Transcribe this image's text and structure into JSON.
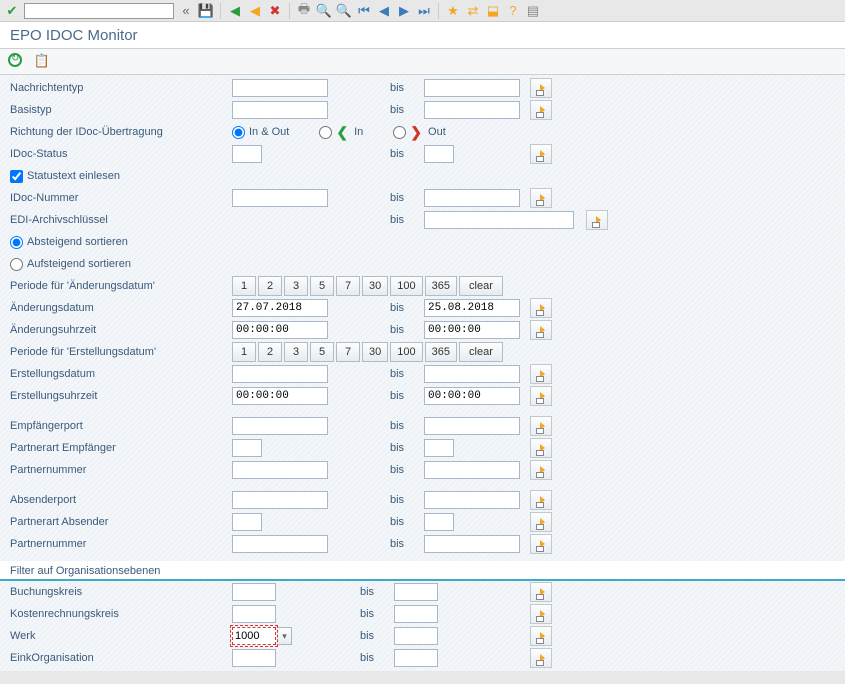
{
  "title": "EPO IDOC Monitor",
  "labels": {
    "nachrichtentyp": "Nachrichtentyp",
    "basistyp": "Basistyp",
    "richtung": "Richtung der IDoc-Übertragung",
    "idoc_status": "IDoc-Status",
    "statustext": "Statustext einlesen",
    "idoc_nummer": "IDoc-Nummer",
    "edi_archiv": "EDI-Archivschlüssel",
    "absteigend": "Absteigend sortieren",
    "aufsteigend": "Aufsteigend sortieren",
    "periode_aenderung": "Periode für 'Änderungsdatum'",
    "aenderungsdatum": "Änderungsdatum",
    "aenderungsuhrzeit": "Änderungsuhrzeit",
    "periode_erstellung": "Periode für 'Erstellungsdatum'",
    "erstellungsdatum": "Erstellungsdatum",
    "erstellungsuhrzeit": "Erstellungsuhrzeit",
    "empfaengerport": "Empfängerport",
    "partnerart_empf": "Partnerart Empfänger",
    "partnernummer_empf": "Partnernummer",
    "absenderport": "Absenderport",
    "partnerart_abs": "Partnerart Absender",
    "partnernummer_abs": "Partnernummer",
    "filter_org": "Filter auf Organisationsebenen",
    "buchungskreis": "Buchungskreis",
    "kostenrechnungskreis": "Kostenrechnungskreis",
    "werk": "Werk",
    "einkorg": "EinkOrganisation",
    "bis": "bis",
    "in_out": "In & Out",
    "in": "In",
    "out": "Out"
  },
  "values": {
    "aenderungsdatum_from": "27.07.2018",
    "aenderungsdatum_to": "25.08.2018",
    "aenderungsuhrzeit_from": "00:00:00",
    "aenderungsuhrzeit_to": "00:00:00",
    "erstellungsuhrzeit_from": "00:00:00",
    "erstellungsuhrzeit_to": "00:00:00",
    "werk_from": "1000"
  },
  "period_buttons": [
    "1",
    "2",
    "3",
    "5",
    "7",
    "30",
    "100",
    "365",
    "clear"
  ]
}
